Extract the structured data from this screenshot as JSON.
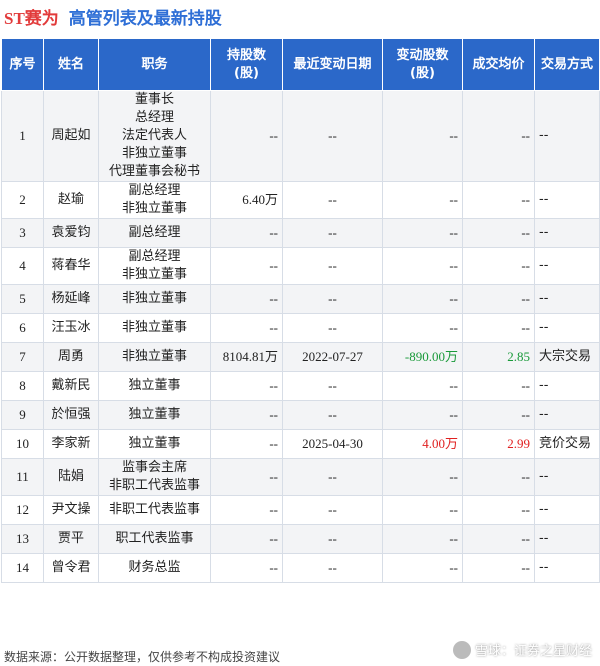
{
  "title": {
    "stock": "ST赛为",
    "main": "高管列表及最新持股"
  },
  "columns": [
    "序号",
    "姓名",
    "职务",
    "持股数\n(股)",
    "最近变动日期",
    "变动股数\n(股)",
    "成交均价",
    "交易方式"
  ],
  "rows": [
    {
      "idx": "1",
      "name": "周起如",
      "role": "董事长\n总经理\n法定代表人\n非独立董事\n代理董事会秘书",
      "shares": "--",
      "date": "--",
      "change": "--",
      "price": "--",
      "mode": "--"
    },
    {
      "idx": "2",
      "name": "赵瑜",
      "role": "副总经理\n非独立董事",
      "shares": "6.40万",
      "date": "--",
      "change": "--",
      "price": "--",
      "mode": "--"
    },
    {
      "idx": "3",
      "name": "袁爱钧",
      "role": "副总经理",
      "shares": "--",
      "date": "--",
      "change": "--",
      "price": "--",
      "mode": "--"
    },
    {
      "idx": "4",
      "name": "蒋春华",
      "role": "副总经理\n非独立董事",
      "shares": "--",
      "date": "--",
      "change": "--",
      "price": "--",
      "mode": "--"
    },
    {
      "idx": "5",
      "name": "杨延峰",
      "role": "非独立董事",
      "shares": "--",
      "date": "--",
      "change": "--",
      "price": "--",
      "mode": "--"
    },
    {
      "idx": "6",
      "name": "汪玉冰",
      "role": "非独立董事",
      "shares": "--",
      "date": "--",
      "change": "--",
      "price": "--",
      "mode": "--"
    },
    {
      "idx": "7",
      "name": "周勇",
      "role": "非独立董事",
      "shares": "8104.81万",
      "date": "2022-07-27",
      "change": "-890.00万",
      "price": "2.85",
      "mode": "大宗交易",
      "change_sign": "neg"
    },
    {
      "idx": "8",
      "name": "戴新民",
      "role": "独立董事",
      "shares": "--",
      "date": "--",
      "change": "--",
      "price": "--",
      "mode": "--"
    },
    {
      "idx": "9",
      "name": "於恒强",
      "role": "独立董事",
      "shares": "--",
      "date": "--",
      "change": "--",
      "price": "--",
      "mode": "--"
    },
    {
      "idx": "10",
      "name": "李家新",
      "role": "独立董事",
      "shares": "--",
      "date": "2025-04-30",
      "change": "4.00万",
      "price": "2.99",
      "mode": "竞价交易",
      "change_sign": "pos"
    },
    {
      "idx": "11",
      "name": "陆娟",
      "role": "监事会主席\n非职工代表监事",
      "shares": "--",
      "date": "--",
      "change": "--",
      "price": "--",
      "mode": "--"
    },
    {
      "idx": "12",
      "name": "尹文操",
      "role": "非职工代表监事",
      "shares": "--",
      "date": "--",
      "change": "--",
      "price": "--",
      "mode": "--"
    },
    {
      "idx": "13",
      "name": "贾平",
      "role": "职工代表监事",
      "shares": "--",
      "date": "--",
      "change": "--",
      "price": "--",
      "mode": "--"
    },
    {
      "idx": "14",
      "name": "曾令君",
      "role": "财务总监",
      "shares": "--",
      "date": "--",
      "change": "--",
      "price": "--",
      "mode": "--"
    }
  ],
  "footer": "数据来源：公开数据整理，仅供参考不构成投资建议",
  "brand": "雪球：证券之星财经",
  "watermark": "证券之星",
  "colors": {
    "header_bg": "#2b68c9",
    "title_blue": "#2f6fd6",
    "title_red": "#e23b3b",
    "pos": "#e02020",
    "neg": "#1a9a3a"
  }
}
